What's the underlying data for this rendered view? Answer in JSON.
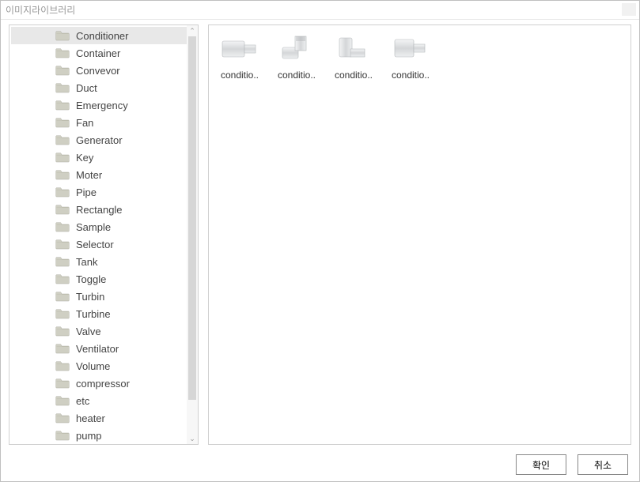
{
  "window": {
    "title": "이미지라이브러리"
  },
  "tree": {
    "selected_index": 0,
    "items": [
      "Conditioner",
      "Container",
      "Convevor",
      "Duct",
      "Emergency",
      "Fan",
      "Generator",
      "Key",
      "Moter",
      "Pipe",
      "Rectangle",
      "Sample",
      "Selector",
      "Tank",
      "Toggle",
      "Turbin",
      "Turbine",
      "Valve",
      "Ventilator",
      "Volume",
      "compressor",
      "etc",
      "heater",
      "pump"
    ]
  },
  "thumbnails": {
    "items": [
      "conditio..",
      "conditio..",
      "conditio..",
      "conditio.."
    ]
  },
  "buttons": {
    "ok": "확인",
    "cancel": "취소"
  }
}
